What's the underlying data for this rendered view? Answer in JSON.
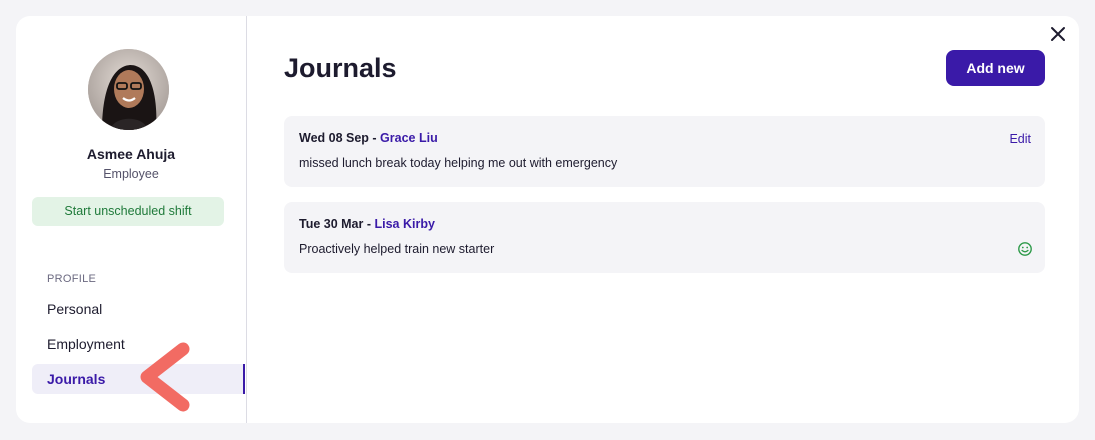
{
  "profile": {
    "name": "Asmee Ahuja",
    "role": "Employee",
    "shift_button": "Start unscheduled shift"
  },
  "sidebar": {
    "section_label": "PROFILE",
    "items": [
      {
        "label": "Personal",
        "active": false
      },
      {
        "label": "Employment",
        "active": false
      },
      {
        "label": "Journals",
        "active": true
      }
    ]
  },
  "main": {
    "title": "Journals",
    "add_button": "Add new",
    "entries": [
      {
        "date": "Wed 08 Sep",
        "separator": " - ",
        "author": "Grace Liu",
        "text": "missed lunch break today helping me out with emergency",
        "action": "Edit",
        "icon": null
      },
      {
        "date": "Tue 30 Mar",
        "separator": " - ",
        "author": "Lisa Kirby",
        "text": "Proactively helped train new starter",
        "action": null,
        "icon": "smiley-icon"
      }
    ]
  },
  "icons": {
    "close": "close-icon",
    "pointer": "arrow-pointer-icon"
  },
  "colors": {
    "accent": "#3a1aa8",
    "shift_bg": "#e3f3e6",
    "shift_text": "#1f7a3a",
    "pointer": "#f26b63",
    "smiley": "#2e9a4a"
  }
}
